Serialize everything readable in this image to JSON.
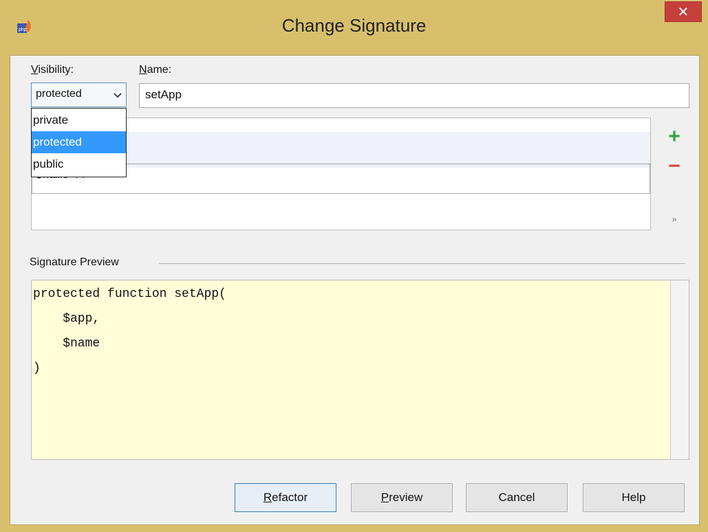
{
  "window": {
    "title": "Change Signature",
    "close_glyph": "✕",
    "app_icon": "php-app-icon"
  },
  "form": {
    "visibility_label": "Visibility:",
    "visibility_mnemonic": "V",
    "visibility_rest": "isibility:",
    "name_label": "Name:",
    "name_mnemonic": "N",
    "name_rest": "ame:",
    "visibility_value": "protected",
    "name_value": "setApp"
  },
  "visibility_dropdown": {
    "options": [
      "private",
      "protected",
      "public"
    ],
    "selected": "protected"
  },
  "parameters": {
    "rows": [
      {
        "text": " $name  // \"\""
      }
    ],
    "add_icon": "plus-icon",
    "remove_icon": "minus-icon",
    "more_icon": "chevron-double-right-icon"
  },
  "preview": {
    "section_title": "Signature Preview",
    "lines": [
      "protected function setApp(",
      "    $app,",
      "    $name",
      ")"
    ]
  },
  "buttons": {
    "refactor": {
      "mn": "R",
      "rest": "efactor"
    },
    "preview": {
      "mn": "P",
      "rest": "review"
    },
    "cancel": "Cancel",
    "help": "Help"
  },
  "colors": {
    "frame": "#d8bf6c",
    "close": "#c6403b",
    "selection": "#3399ff",
    "preview_bg": "#fffed9"
  }
}
